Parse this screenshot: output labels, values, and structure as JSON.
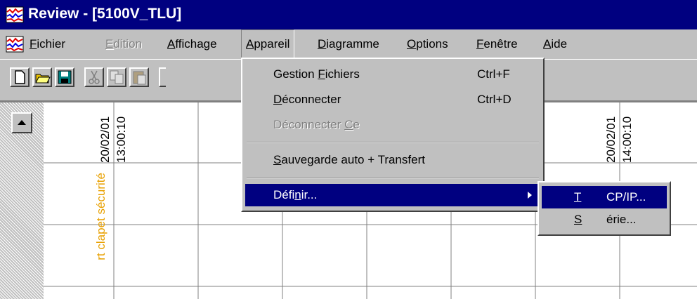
{
  "window": {
    "title": "Review - [5100V_TLU]",
    "app_icon": "chart-app-icon"
  },
  "menubar": {
    "fichier": {
      "pre": "",
      "key": "F",
      "post": "ichier"
    },
    "edition": {
      "pre": "",
      "key": "E",
      "post": "dition"
    },
    "affichage": {
      "pre": "",
      "key": "A",
      "post": "ffichage"
    },
    "appareil": {
      "pre": "",
      "key": "A",
      "post": "ppareil"
    },
    "diagramme": {
      "pre": "",
      "key": "D",
      "post": "iagramme"
    },
    "options": {
      "pre": "",
      "key": "O",
      "post": "ptions"
    },
    "fenetre": {
      "pre": "",
      "key": "F",
      "post": "enêtre"
    },
    "aide": {
      "pre": "",
      "key": "A",
      "post": "ide"
    }
  },
  "toolbar": {
    "buttons": [
      "new-icon",
      "open-icon",
      "save-icon",
      "cut-icon",
      "copy-icon",
      "paste-icon"
    ]
  },
  "chart": {
    "time1_date": "20/02/01",
    "time1_time": "13:00:10",
    "time2_date": "20/02/01",
    "time2_time": "14:00:10",
    "channel_label": "rt clapet sécurité",
    "channel_color": "#e8a000"
  },
  "appareil_menu": {
    "gestion": {
      "pre": "Gestion ",
      "key": "F",
      "post": "ichiers",
      "shortcut": "Ctrl+F"
    },
    "deconnecter": {
      "pre": "",
      "key": "D",
      "post": "éconnecter",
      "shortcut": "Ctrl+D"
    },
    "deconnecter_ce": {
      "pre": "Déconnecter ",
      "key": "C",
      "post": "e"
    },
    "sauvegarde": {
      "pre": "",
      "key": "S",
      "post": "auvegarde auto + Transfert"
    },
    "definir": {
      "pre": "Défi",
      "key": "n",
      "post": "ir..."
    }
  },
  "definir_submenu": {
    "tcpip": {
      "pre": "",
      "key": "T",
      "post": "CP/IP..."
    },
    "serie": {
      "pre": "",
      "key": "S",
      "post": "érie..."
    }
  }
}
